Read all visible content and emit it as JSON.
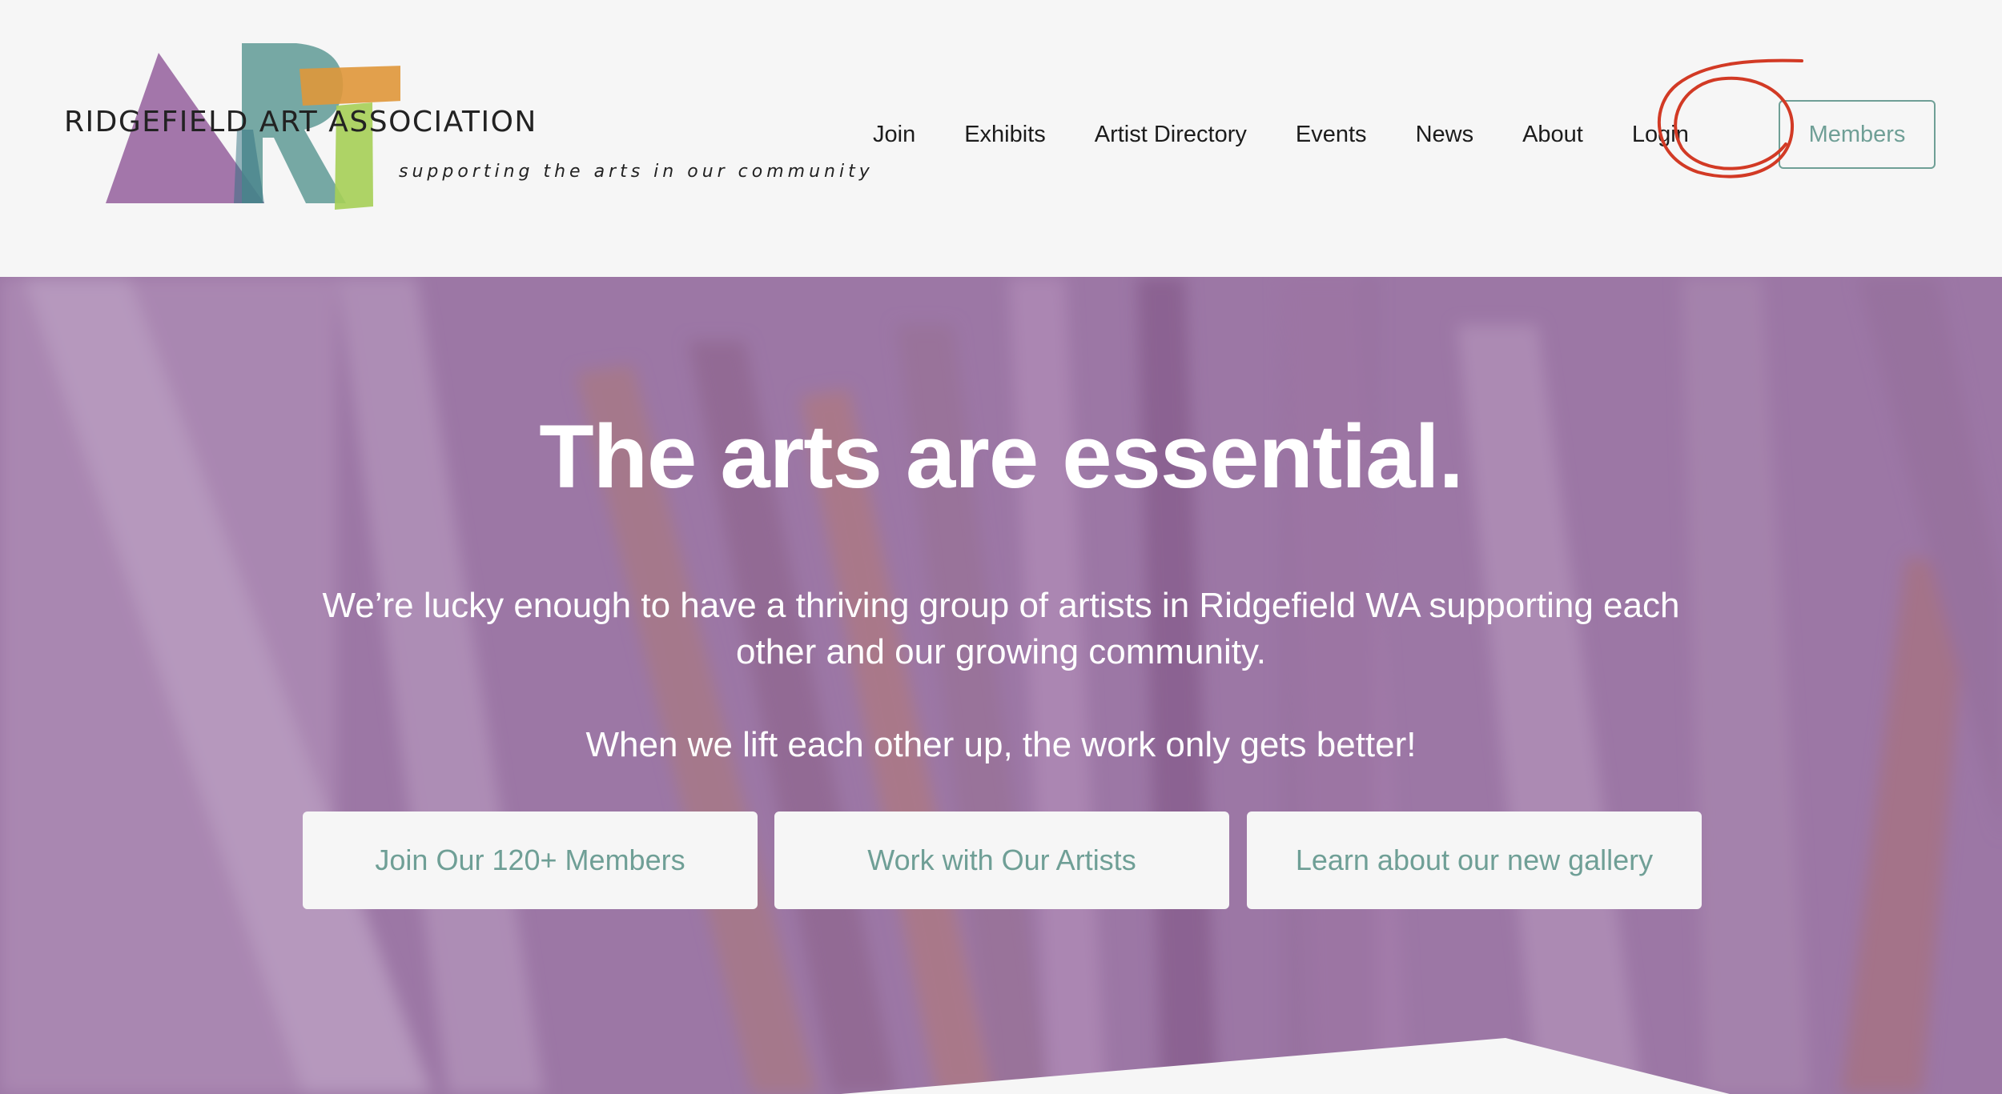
{
  "brand": {
    "name": "RIDGEFIELD ART ASSOCIATION",
    "tagline": "supporting the arts in our community",
    "colors": {
      "purple": "#9b6aa3",
      "teal": "#5f9a95",
      "orange": "#e0973a",
      "green": "#a6cf57"
    }
  },
  "nav": {
    "items": [
      {
        "label": "Join"
      },
      {
        "label": "Exhibits"
      },
      {
        "label": "Artist Directory"
      },
      {
        "label": "Events"
      },
      {
        "label": "News"
      },
      {
        "label": "About"
      },
      {
        "label": "Login"
      }
    ],
    "members_label": "Members"
  },
  "hero": {
    "title": "The arts are essential.",
    "paragraph_1": "We’re lucky enough to have a thriving group of artists in Ridgefield WA supporting each other and our growing community.",
    "paragraph_2": "When we lift each other up, the work only gets better!",
    "buttons": [
      {
        "label": "Join Our 120+ Members"
      },
      {
        "label": "Work with Our Artists"
      },
      {
        "label": "Learn about our new gallery"
      }
    ]
  },
  "theme": {
    "accent": "#6f9f96",
    "annotation_circle": "#d23a25",
    "hero_tint": "#96699f"
  }
}
